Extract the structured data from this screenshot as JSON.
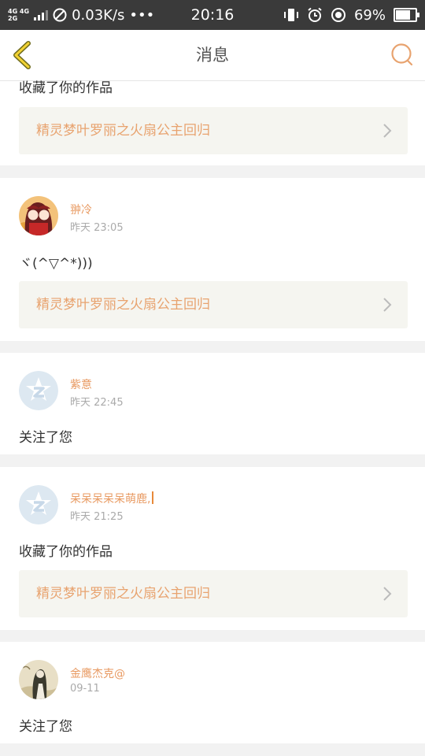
{
  "status": {
    "network_top": "4G 4G",
    "network_bottom": "2G",
    "speed": "0.03K/s",
    "more": "•••",
    "time": "20:16",
    "battery": "69%",
    "battery_level": 0.69
  },
  "nav": {
    "title": "消息"
  },
  "colors": {
    "accent": "#e89a62",
    "work_bg": "#f5f5f0"
  },
  "items": [
    {
      "message": "收藏了你的作品",
      "work": "精灵梦叶罗丽之火扇公主回归"
    },
    {
      "name": "翀冷",
      "time": "昨天 23:05",
      "message": "ヾ(^▽^*)))",
      "work": "精灵梦叶罗丽之火扇公主回归"
    },
    {
      "name": "紫意",
      "time": "昨天 22:45",
      "message": "关注了您"
    },
    {
      "name": "呆呆呆呆呆萌鹿,",
      "time": "昨天 21:25",
      "message": "收藏了你的作品",
      "work": "精灵梦叶罗丽之火扇公主回归"
    },
    {
      "name": "金鹰杰克@",
      "time": "09-11",
      "message": "关注了您"
    }
  ]
}
